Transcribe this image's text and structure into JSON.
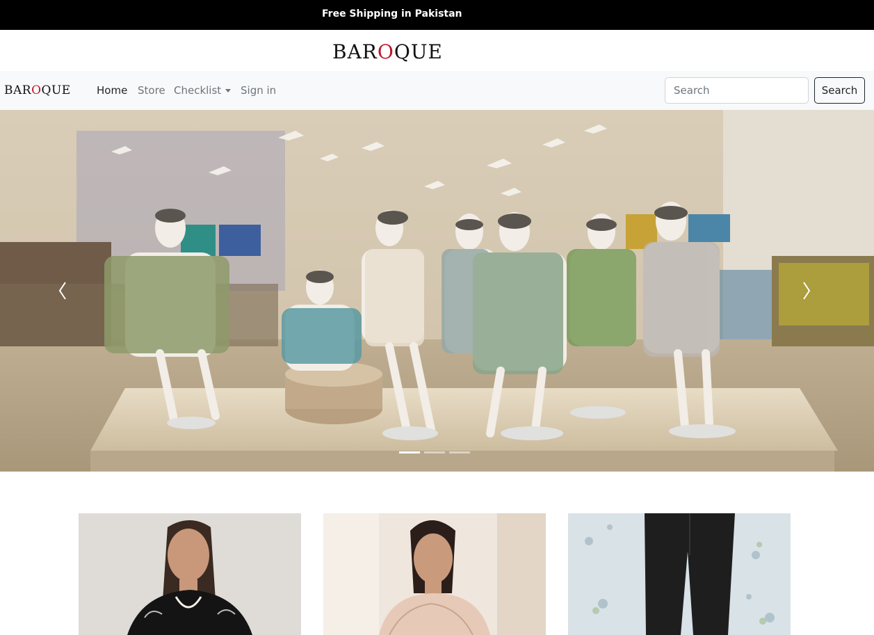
{
  "announcement": "Free Shipping in Pakistan",
  "brand": {
    "text_before": "BAR",
    "accent": "O",
    "text_after": "QUE",
    "accent_color": "#c0142a"
  },
  "nav": {
    "items": [
      {
        "label": "Home",
        "active": true
      },
      {
        "label": "Store",
        "active": false
      },
      {
        "label": "Checklist",
        "active": false,
        "dropdown": true
      },
      {
        "label": "Sign in",
        "active": false
      }
    ],
    "search_placeholder": "Search",
    "search_button": "Search"
  },
  "carousel": {
    "slide_count": 3,
    "active_index": 0,
    "prev_icon": "chevron-left-icon",
    "next_icon": "chevron-right-icon"
  },
  "products": [
    {
      "image": "model-black-embroidered-outfit"
    },
    {
      "image": "model-peach-embroidered-outfit"
    },
    {
      "image": "black-trousers-floral-wall"
    }
  ]
}
